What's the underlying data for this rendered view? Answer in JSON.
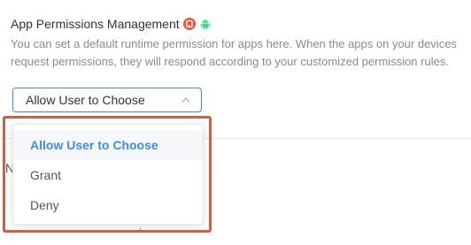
{
  "section": {
    "title": "App Permissions Management",
    "description": "You can set a default runtime permission for apps here. When the apps on your devices request permissions, they will respond according to your customized permission rules.",
    "platform_icons": [
      "ios-icon",
      "android-icon"
    ]
  },
  "colors": {
    "accent": "#3a8ee6",
    "highlight_border": "#d35f3e",
    "ios_badge": "#e2583e",
    "android": "#3ddc84"
  },
  "permission_select": {
    "value": "Allow User to Choose",
    "options": [
      {
        "label": "Allow User to Choose",
        "selected": true
      },
      {
        "label": "Grant",
        "selected": false
      },
      {
        "label": "Deny",
        "selected": false
      }
    ]
  },
  "background_fragments": {
    "left_char": "N",
    "bottom_char": ","
  }
}
